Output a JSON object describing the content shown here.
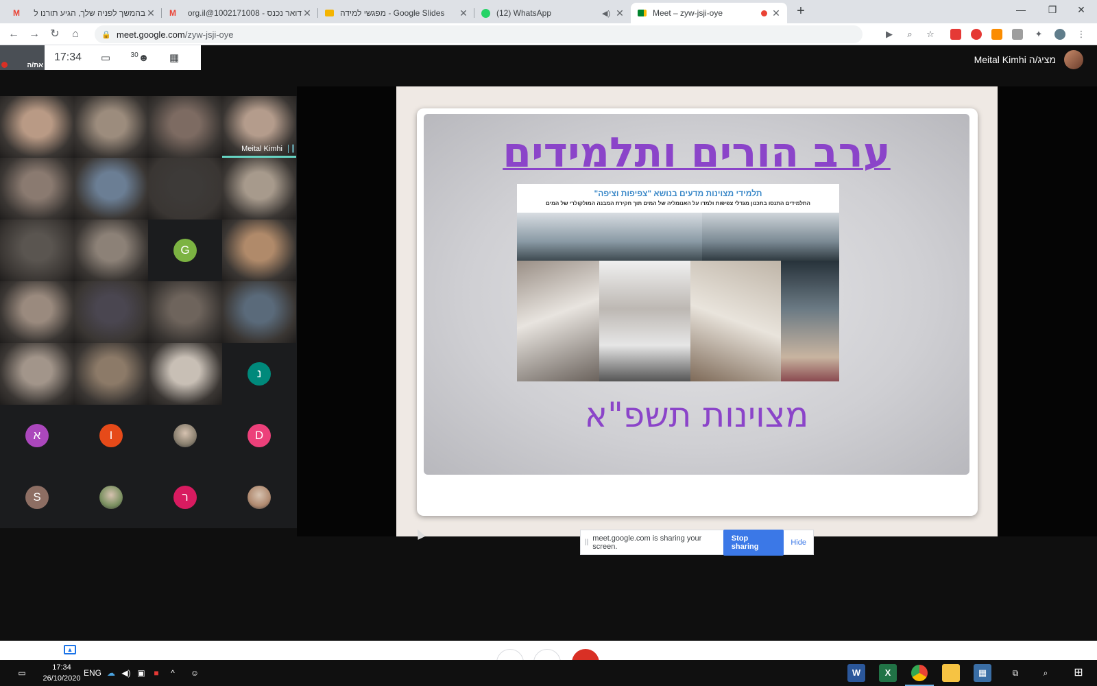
{
  "browser": {
    "tabs": [
      {
        "title": "בהמשך לפניה שלך, הגיע תורנו ל",
        "icon": "gmail-icon",
        "color": "#ea4335"
      },
      {
        "title": "דואר נכנס - 1002171008@org.il",
        "icon": "gmail-icon",
        "color": "#ea4335"
      },
      {
        "title": "מפגשי למידה - Google Slides",
        "icon": "slides-icon",
        "color": "#f4b400"
      },
      {
        "title": "(12) WhatsApp",
        "icon": "whatsapp-icon",
        "color": "#25d366",
        "badge": "12"
      },
      {
        "title": "Meet – zyw-jsji-oye",
        "icon": "meet-icon",
        "color": "#00832d",
        "active": true
      }
    ],
    "url_host": "meet.google.com",
    "url_path": "/zyw-jsji-oye"
  },
  "meet": {
    "time": "17:34",
    "self_label": "את/ה",
    "participant_count": "30",
    "presenter_text": "Meital Kimhi מציג/ה",
    "speaker_name": "Meital Kimhi",
    "participants": [
      {
        "type": "video",
        "tone": "#b99a85"
      },
      {
        "type": "video",
        "tone": "#9c8c7d"
      },
      {
        "type": "video",
        "tone": "#7d6b62"
      },
      {
        "type": "video",
        "tone": "#b49c8c",
        "name": "Meital Kimhi",
        "speaking": true
      },
      {
        "type": "video",
        "tone": "#8a7a70"
      },
      {
        "type": "video",
        "tone": "#6b7e94"
      },
      {
        "type": "video",
        "tone": "#3d3a38"
      },
      {
        "type": "video",
        "tone": "#a79a8c"
      },
      {
        "type": "video",
        "tone": "#5a5550"
      },
      {
        "type": "video",
        "tone": "#8c8177"
      },
      {
        "type": "letter",
        "letter": "G",
        "color": "#7cb342"
      },
      {
        "type": "video",
        "tone": "#b08a6a"
      },
      {
        "type": "video",
        "tone": "#9a8a7e"
      },
      {
        "type": "video",
        "tone": "#4a4650"
      },
      {
        "type": "video",
        "tone": "#6e645c"
      },
      {
        "type": "video",
        "tone": "#5a6a7a"
      },
      {
        "type": "video",
        "tone": "#a2958a"
      },
      {
        "type": "video",
        "tone": "#8c7a68"
      },
      {
        "type": "video",
        "tone": "#c8bfb5"
      },
      {
        "type": "letter",
        "letter": "נ",
        "color": "#00897b"
      },
      {
        "type": "letter",
        "letter": "א",
        "color": "#ab47bc"
      },
      {
        "type": "letter",
        "letter": "I",
        "color": "#e64a19"
      },
      {
        "type": "photo",
        "color": "#8a8070"
      },
      {
        "type": "letter",
        "letter": "D",
        "color": "#ec407a"
      },
      {
        "type": "letter",
        "letter": "S",
        "color": "#8d6e63"
      },
      {
        "type": "photo",
        "color": "#7a9060"
      },
      {
        "type": "letter",
        "letter": "ר",
        "color": "#d81b60"
      },
      {
        "type": "photo",
        "color": "#b08a70"
      }
    ]
  },
  "slide": {
    "title": "ערב הורים ותלמידים",
    "poster_heading": "תלמידי מצוינות מדעים בנושא \"צפיפות וציפה\"",
    "poster_subheading": "התלמידים התנסו בתכנון מגדלי צפיפות ולמדו על האנומליה של המים תוך חקירת המבנה המולקולרי של המים",
    "subtitle": "מצוינות תשפ\"א"
  },
  "share_bar": {
    "message": "meet.google.com is sharing your screen.",
    "stop_label": "Stop sharing",
    "hide_label": "Hide"
  },
  "taskbar": {
    "time": "17:34",
    "date": "26/10/2020",
    "lang": "ENG"
  }
}
